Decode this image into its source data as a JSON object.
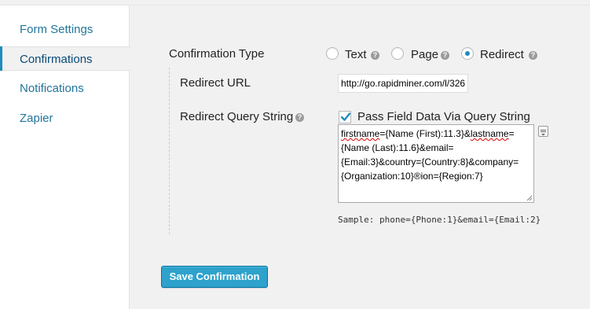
{
  "sidebar": {
    "items": [
      {
        "label": "Form Settings"
      },
      {
        "label": "Confirmations"
      },
      {
        "label": "Notifications"
      },
      {
        "label": "Zapier"
      }
    ]
  },
  "confirmation_type": {
    "label": "Confirmation Type",
    "options": [
      {
        "label": "Text",
        "checked": false
      },
      {
        "label": "Page",
        "checked": false
      },
      {
        "label": "Redirect",
        "checked": true
      }
    ]
  },
  "redirect_url": {
    "label": "Redirect URL",
    "value": "http://go.rapidminer.com/l/326"
  },
  "query_string": {
    "label": "Redirect Query String",
    "checkbox_label": "Pass Field Data Via Query String",
    "checked": true,
    "value_parts": [
      "firstname",
      "={Name (First):11.3}&",
      "lastname",
      "={Name (Last):11.6}&email={Email:3}&country={Country:8}&company={Organization:10}®ion={Region:7}"
    ],
    "sample": "Sample: phone={Phone:1}&email={Email:2}"
  },
  "save_button": {
    "label": "Save Confirmation"
  },
  "colors": {
    "accent": "#2ea2cc",
    "link": "#21759b"
  },
  "icons": {
    "help": "question-circle-icon",
    "merge_tag": "merge-tag-icon"
  }
}
